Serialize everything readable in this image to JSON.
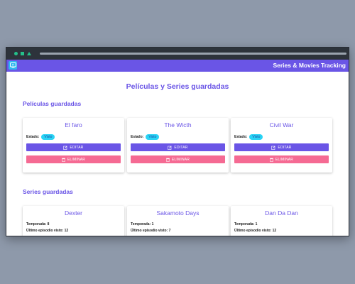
{
  "app": {
    "brand": "Series & Movies Tracking"
  },
  "page": {
    "title": "Películas y Series guardadas",
    "movies_section": "Películas guardadas",
    "series_section": "Series guardadas"
  },
  "labels": {
    "status": "Estado:",
    "edit": "EDITAR",
    "delete": "ELIMINAR",
    "season": "Temporada:",
    "last_episode": "Último episodio visto:"
  },
  "movies": [
    {
      "title": "El faro",
      "status": "Visto"
    },
    {
      "title": "The Wicth",
      "status": "Visto"
    },
    {
      "title": "Civil War",
      "status": "Visto"
    }
  ],
  "series": [
    {
      "title": "Dexter",
      "season": "8",
      "last_episode": "12"
    },
    {
      "title": "Sakamoto Days",
      "season": "1",
      "last_episode": "7"
    },
    {
      "title": "Dan Da Dan",
      "season": "1",
      "last_episode": "12"
    }
  ],
  "colors": {
    "primary": "#6a55e6",
    "danger": "#f56a93",
    "badge": "#2ad4f5",
    "logo": "#2fb7f0"
  }
}
